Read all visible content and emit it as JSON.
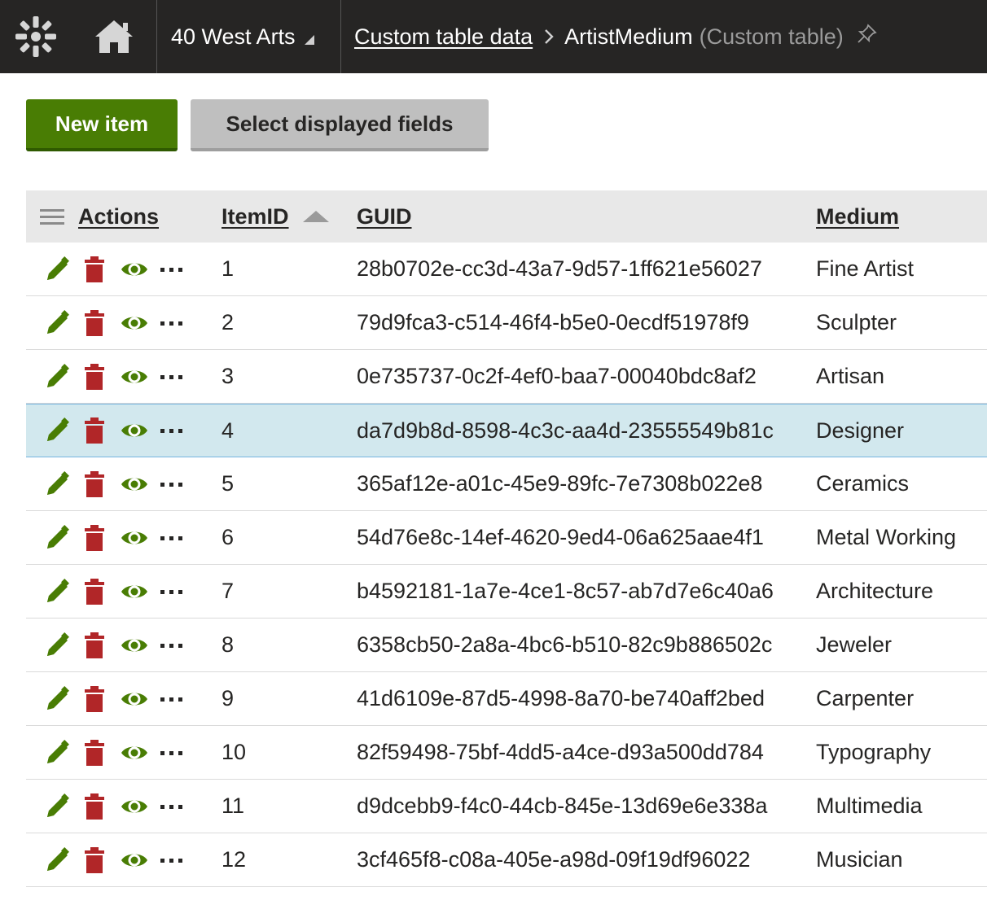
{
  "header": {
    "site_name": "40 West Arts",
    "breadcrumb_link": "Custom table data",
    "breadcrumb_current": "ArtistMedium",
    "breadcrumb_suffix": "(Custom table)"
  },
  "toolbar": {
    "new_item_label": "New item",
    "select_fields_label": "Select displayed fields"
  },
  "table": {
    "columns": {
      "actions": "Actions",
      "item_id": "ItemID",
      "guid": "GUID",
      "medium": "Medium"
    },
    "rows": [
      {
        "id": "1",
        "guid": "28b0702e-cc3d-43a7-9d57-1ff621e56027",
        "medium": "Fine Artist"
      },
      {
        "id": "2",
        "guid": "79d9fca3-c514-46f4-b5e0-0ecdf51978f9",
        "medium": "Sculpter"
      },
      {
        "id": "3",
        "guid": "0e735737-0c2f-4ef0-baa7-00040bdc8af2",
        "medium": "Artisan"
      },
      {
        "id": "4",
        "guid": "da7d9b8d-8598-4c3c-aa4d-23555549b81c",
        "medium": "Designer"
      },
      {
        "id": "5",
        "guid": "365af12e-a01c-45e9-89fc-7e7308b022e8",
        "medium": "Ceramics"
      },
      {
        "id": "6",
        "guid": "54d76e8c-14ef-4620-9ed4-06a625aae4f1",
        "medium": "Metal Working"
      },
      {
        "id": "7",
        "guid": "b4592181-1a7e-4ce1-8c57-ab7d7e6c40a6",
        "medium": "Architecture"
      },
      {
        "id": "8",
        "guid": "6358cb50-2a8a-4bc6-b510-82c9b886502c",
        "medium": "Jeweler"
      },
      {
        "id": "9",
        "guid": "41d6109e-87d5-4998-8a70-be740aff2bed",
        "medium": "Carpenter"
      },
      {
        "id": "10",
        "guid": "82f59498-75bf-4dd5-a4ce-d93a500dd784",
        "medium": "Typography"
      },
      {
        "id": "11",
        "guid": "d9dcebb9-f4c0-44cb-845e-13d69e6e338a",
        "medium": "Multimedia"
      },
      {
        "id": "12",
        "guid": "3cf465f8-c08a-405e-a98d-09f19df96022",
        "medium": "Musician"
      }
    ]
  },
  "colors": {
    "header_bg": "#262524",
    "primary_green": "#497d04",
    "delete_red": "#b12628",
    "selected_row_bg": "#d2e8ee"
  },
  "icons": {
    "row_actions": [
      "edit-pencil-icon",
      "delete-trash-icon",
      "view-eye-icon",
      "more-options-icon"
    ]
  }
}
